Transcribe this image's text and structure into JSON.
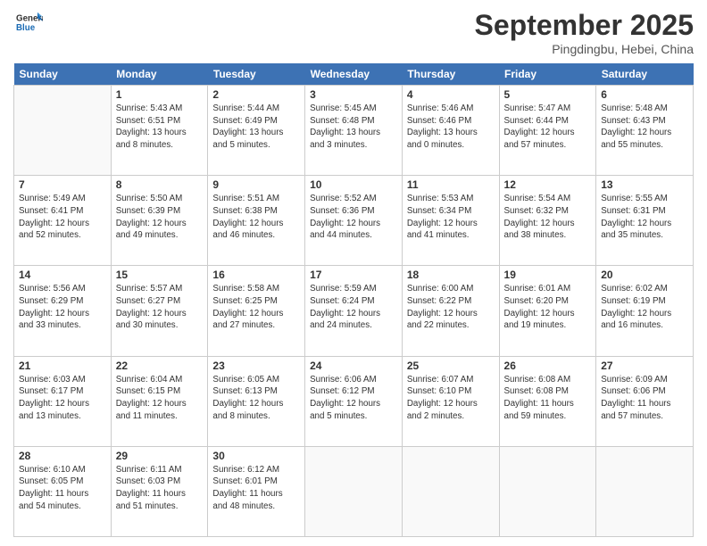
{
  "header": {
    "logo_line1": "General",
    "logo_line2": "Blue",
    "month_title": "September 2025",
    "location": "Pingdingbu, Hebei, China"
  },
  "weekdays": [
    "Sunday",
    "Monday",
    "Tuesday",
    "Wednesday",
    "Thursday",
    "Friday",
    "Saturday"
  ],
  "weeks": [
    [
      {
        "day": null,
        "info": null
      },
      {
        "day": "1",
        "info": "Sunrise: 5:43 AM\nSunset: 6:51 PM\nDaylight: 13 hours\nand 8 minutes."
      },
      {
        "day": "2",
        "info": "Sunrise: 5:44 AM\nSunset: 6:49 PM\nDaylight: 13 hours\nand 5 minutes."
      },
      {
        "day": "3",
        "info": "Sunrise: 5:45 AM\nSunset: 6:48 PM\nDaylight: 13 hours\nand 3 minutes."
      },
      {
        "day": "4",
        "info": "Sunrise: 5:46 AM\nSunset: 6:46 PM\nDaylight: 13 hours\nand 0 minutes."
      },
      {
        "day": "5",
        "info": "Sunrise: 5:47 AM\nSunset: 6:44 PM\nDaylight: 12 hours\nand 57 minutes."
      },
      {
        "day": "6",
        "info": "Sunrise: 5:48 AM\nSunset: 6:43 PM\nDaylight: 12 hours\nand 55 minutes."
      }
    ],
    [
      {
        "day": "7",
        "info": "Sunrise: 5:49 AM\nSunset: 6:41 PM\nDaylight: 12 hours\nand 52 minutes."
      },
      {
        "day": "8",
        "info": "Sunrise: 5:50 AM\nSunset: 6:39 PM\nDaylight: 12 hours\nand 49 minutes."
      },
      {
        "day": "9",
        "info": "Sunrise: 5:51 AM\nSunset: 6:38 PM\nDaylight: 12 hours\nand 46 minutes."
      },
      {
        "day": "10",
        "info": "Sunrise: 5:52 AM\nSunset: 6:36 PM\nDaylight: 12 hours\nand 44 minutes."
      },
      {
        "day": "11",
        "info": "Sunrise: 5:53 AM\nSunset: 6:34 PM\nDaylight: 12 hours\nand 41 minutes."
      },
      {
        "day": "12",
        "info": "Sunrise: 5:54 AM\nSunset: 6:32 PM\nDaylight: 12 hours\nand 38 minutes."
      },
      {
        "day": "13",
        "info": "Sunrise: 5:55 AM\nSunset: 6:31 PM\nDaylight: 12 hours\nand 35 minutes."
      }
    ],
    [
      {
        "day": "14",
        "info": "Sunrise: 5:56 AM\nSunset: 6:29 PM\nDaylight: 12 hours\nand 33 minutes."
      },
      {
        "day": "15",
        "info": "Sunrise: 5:57 AM\nSunset: 6:27 PM\nDaylight: 12 hours\nand 30 minutes."
      },
      {
        "day": "16",
        "info": "Sunrise: 5:58 AM\nSunset: 6:25 PM\nDaylight: 12 hours\nand 27 minutes."
      },
      {
        "day": "17",
        "info": "Sunrise: 5:59 AM\nSunset: 6:24 PM\nDaylight: 12 hours\nand 24 minutes."
      },
      {
        "day": "18",
        "info": "Sunrise: 6:00 AM\nSunset: 6:22 PM\nDaylight: 12 hours\nand 22 minutes."
      },
      {
        "day": "19",
        "info": "Sunrise: 6:01 AM\nSunset: 6:20 PM\nDaylight: 12 hours\nand 19 minutes."
      },
      {
        "day": "20",
        "info": "Sunrise: 6:02 AM\nSunset: 6:19 PM\nDaylight: 12 hours\nand 16 minutes."
      }
    ],
    [
      {
        "day": "21",
        "info": "Sunrise: 6:03 AM\nSunset: 6:17 PM\nDaylight: 12 hours\nand 13 minutes."
      },
      {
        "day": "22",
        "info": "Sunrise: 6:04 AM\nSunset: 6:15 PM\nDaylight: 12 hours\nand 11 minutes."
      },
      {
        "day": "23",
        "info": "Sunrise: 6:05 AM\nSunset: 6:13 PM\nDaylight: 12 hours\nand 8 minutes."
      },
      {
        "day": "24",
        "info": "Sunrise: 6:06 AM\nSunset: 6:12 PM\nDaylight: 12 hours\nand 5 minutes."
      },
      {
        "day": "25",
        "info": "Sunrise: 6:07 AM\nSunset: 6:10 PM\nDaylight: 12 hours\nand 2 minutes."
      },
      {
        "day": "26",
        "info": "Sunrise: 6:08 AM\nSunset: 6:08 PM\nDaylight: 11 hours\nand 59 minutes."
      },
      {
        "day": "27",
        "info": "Sunrise: 6:09 AM\nSunset: 6:06 PM\nDaylight: 11 hours\nand 57 minutes."
      }
    ],
    [
      {
        "day": "28",
        "info": "Sunrise: 6:10 AM\nSunset: 6:05 PM\nDaylight: 11 hours\nand 54 minutes."
      },
      {
        "day": "29",
        "info": "Sunrise: 6:11 AM\nSunset: 6:03 PM\nDaylight: 11 hours\nand 51 minutes."
      },
      {
        "day": "30",
        "info": "Sunrise: 6:12 AM\nSunset: 6:01 PM\nDaylight: 11 hours\nand 48 minutes."
      },
      {
        "day": null,
        "info": null
      },
      {
        "day": null,
        "info": null
      },
      {
        "day": null,
        "info": null
      },
      {
        "day": null,
        "info": null
      }
    ]
  ]
}
